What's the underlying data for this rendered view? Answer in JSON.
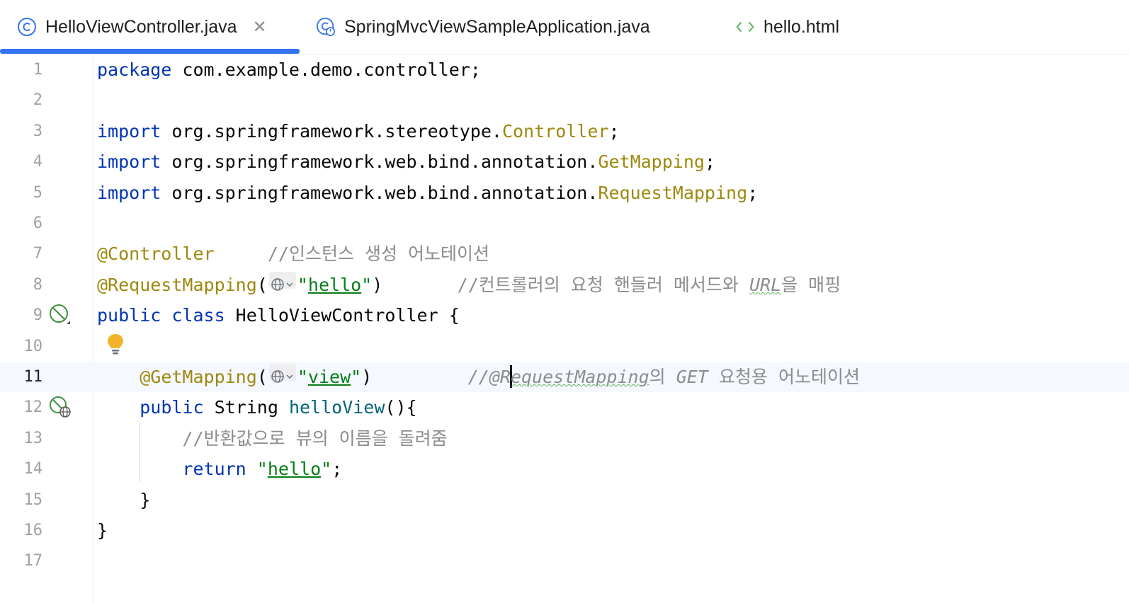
{
  "tabs": [
    {
      "label": "HelloViewController.java",
      "icon": "class-icon",
      "active": true,
      "closable": true,
      "close_glyph": "✕"
    },
    {
      "label": "SpringMvcViewSampleApplication.java",
      "icon": "spring-boot-class-icon",
      "active": false
    },
    {
      "label": "hello.html",
      "icon": "html-icon",
      "active": false
    }
  ],
  "editor": {
    "current_line": 11,
    "line_numbers": [
      "1",
      "2",
      "3",
      "4",
      "5",
      "6",
      "7",
      "8",
      "9",
      "10",
      "11",
      "12",
      "13",
      "14",
      "15",
      "16",
      "17"
    ],
    "lines": {
      "l1": {
        "kw": "package",
        "rest": " com.example.demo.controller;"
      },
      "l3": {
        "kw": "import",
        "pkg": " org.springframework.stereotype.",
        "cls": "Controller",
        "end": ";"
      },
      "l4": {
        "kw": "import",
        "pkg": " org.springframework.web.bind.annotation.",
        "cls": "GetMapping",
        "end": ";"
      },
      "l5": {
        "kw": "import",
        "pkg": " org.springframework.web.bind.annotation.",
        "cls": "RequestMapping",
        "end": ";"
      },
      "l7": {
        "anno": "@Controller",
        "gap": "     ",
        "comment": "//인스턴스 생성 어노테이션"
      },
      "l8": {
        "anno": "@RequestMapping",
        "open": "(",
        "q1": "\"",
        "str": "hello",
        "q2": "\"",
        "close": ")",
        "gap": "       ",
        "comment_a": "//컨트롤러의 요청 핸들러 메서드와 ",
        "comment_url": "URL",
        "comment_b": "을 매핑"
      },
      "l9": {
        "kw": "public class",
        "rest": " HelloViewController {"
      },
      "l11": {
        "indent": "    ",
        "anno": "@GetMapping",
        "open": "(",
        "q1": "\"",
        "str": "view",
        "q2": "\"",
        "close": ")",
        "gap": "         ",
        "c1": "//@R",
        "c2": "equestMapping",
        "c3": "의 ",
        "c4": "GET",
        "c5": " 요청용 어노테이션"
      },
      "l12": {
        "indent": "    ",
        "kw": "public",
        "type": " String ",
        "fn": "helloView",
        "rest": "(){"
      },
      "l13": {
        "indent": "        ",
        "comment": "//반환값으로 뷰의 이름을 돌려줌"
      },
      "l14": {
        "indent": "        ",
        "kw": "return",
        "sp": " ",
        "q1": "\"",
        "str": "hello",
        "q2": "\"",
        "end": ";"
      },
      "l15": {
        "indent": "    ",
        "text": "}"
      },
      "l16": {
        "text": "}"
      }
    }
  },
  "colors": {
    "keyword": "#0033b3",
    "annotation": "#9e880d",
    "string": "#067d17",
    "comment": "#8c8c8c",
    "accent": "#3574f0",
    "current_line_bg": "#f5f8fe"
  }
}
